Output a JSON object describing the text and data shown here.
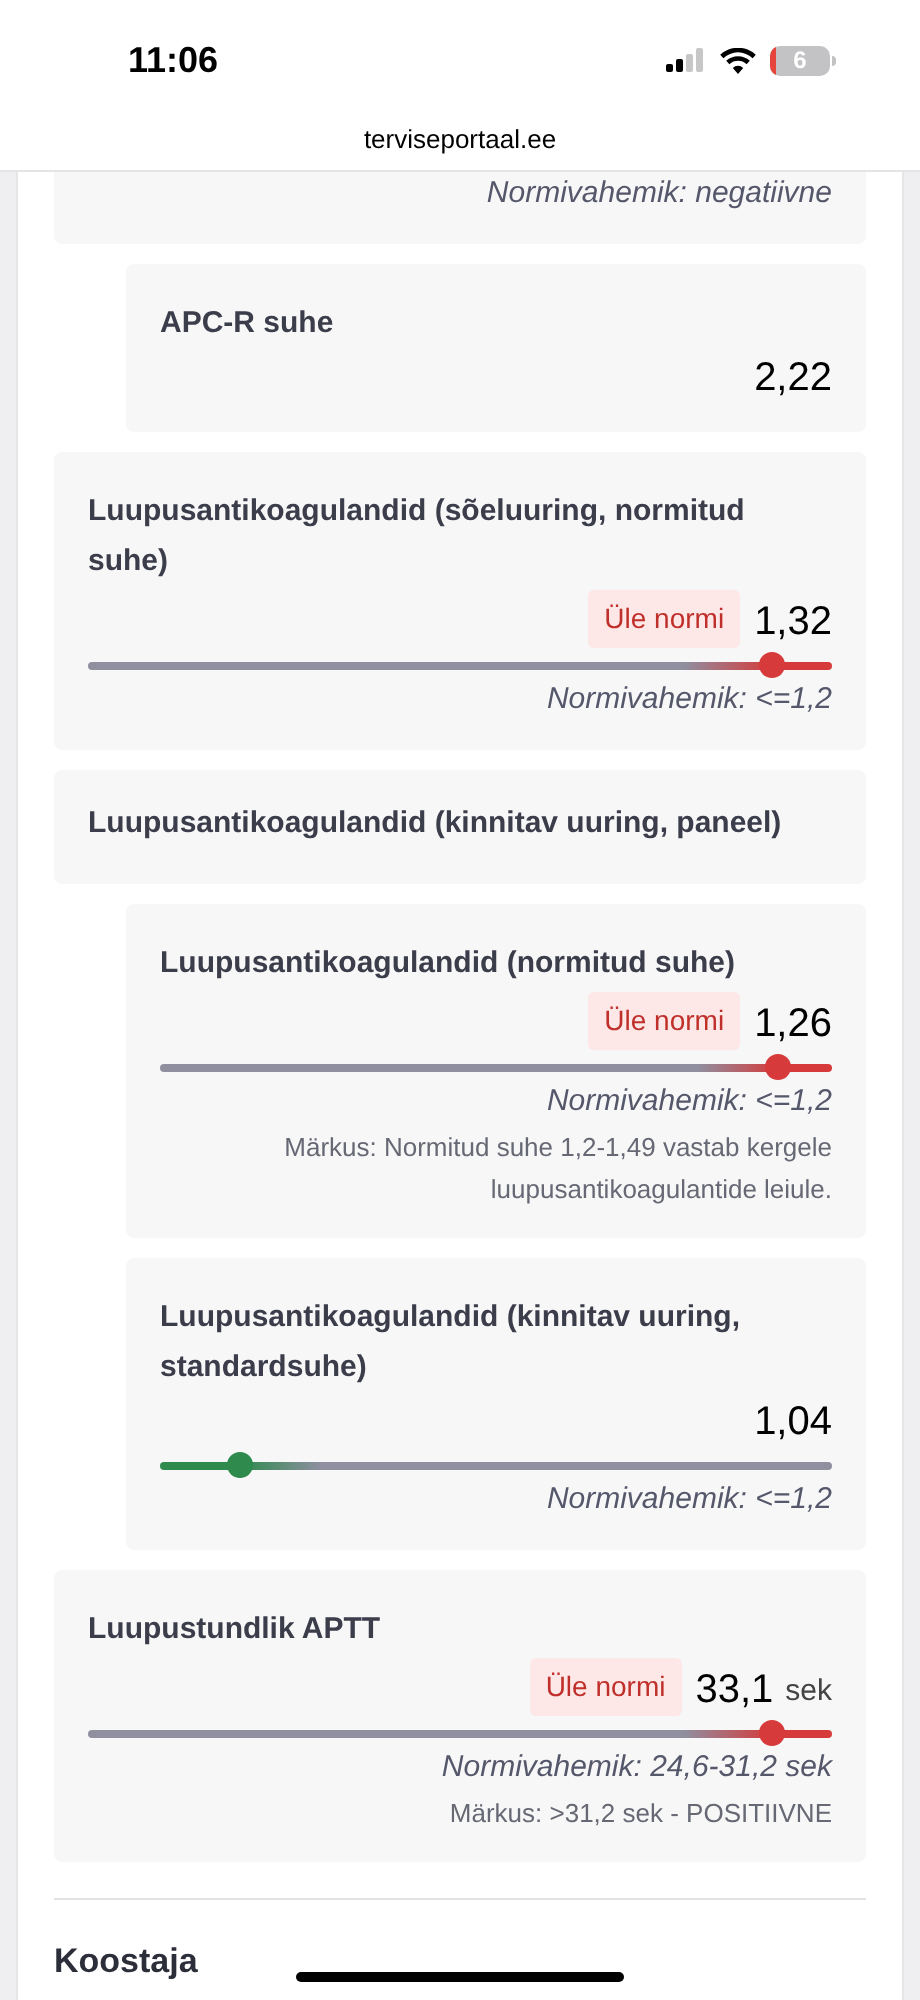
{
  "status_bar": {
    "time": "11:06",
    "battery": "6"
  },
  "browser": {
    "url": "terviseportaal.ee"
  },
  "results": [
    {
      "kind": "range_only",
      "range": "Normivahemik: negatiivne"
    },
    {
      "kind": "group",
      "children": [
        {
          "kind": "value",
          "title": "APC-R suhe",
          "value": "2,22"
        }
      ]
    },
    {
      "kind": "slider",
      "title": "Luupusantikoagulandid (sõeluuring, normitud suhe)",
      "badge": "Üle normi",
      "value": "1,32",
      "over_range": true,
      "level": 0.92,
      "range": "Normivahemik: <=1,2"
    },
    {
      "kind": "group",
      "title": "Luupusantikoagulandid (kinnitav uuring, paneel)",
      "children": [
        {
          "kind": "slider",
          "title": "Luupusantikoagulandid (normitud suhe)",
          "badge": "Üle normi",
          "value": "1,26",
          "over_range": true,
          "level": 0.92,
          "range": "Normivahemik: <=1,2",
          "note": "Märkus: Normitud suhe 1,2-1,49 vastab kergele luupusantikoagulantide leiule."
        },
        {
          "kind": "slider",
          "title": "Luupusantikoagulandid (kinnitav uuring, standardsuhe)",
          "value": "1,04",
          "over_range": false,
          "level": 0.12,
          "range": "Normivahemik: <=1,2"
        }
      ]
    },
    {
      "kind": "slider",
      "title": "Luupustundlik APTT",
      "badge": "Üle normi",
      "value": "33,1",
      "unit": "sek",
      "over_range": true,
      "level": 0.92,
      "range": "Normivahemik: 24,6-31,2 sek",
      "note": "Märkus: >31,2 sek - POSITIIVNE"
    }
  ],
  "section": {
    "title": "Koostaja"
  }
}
